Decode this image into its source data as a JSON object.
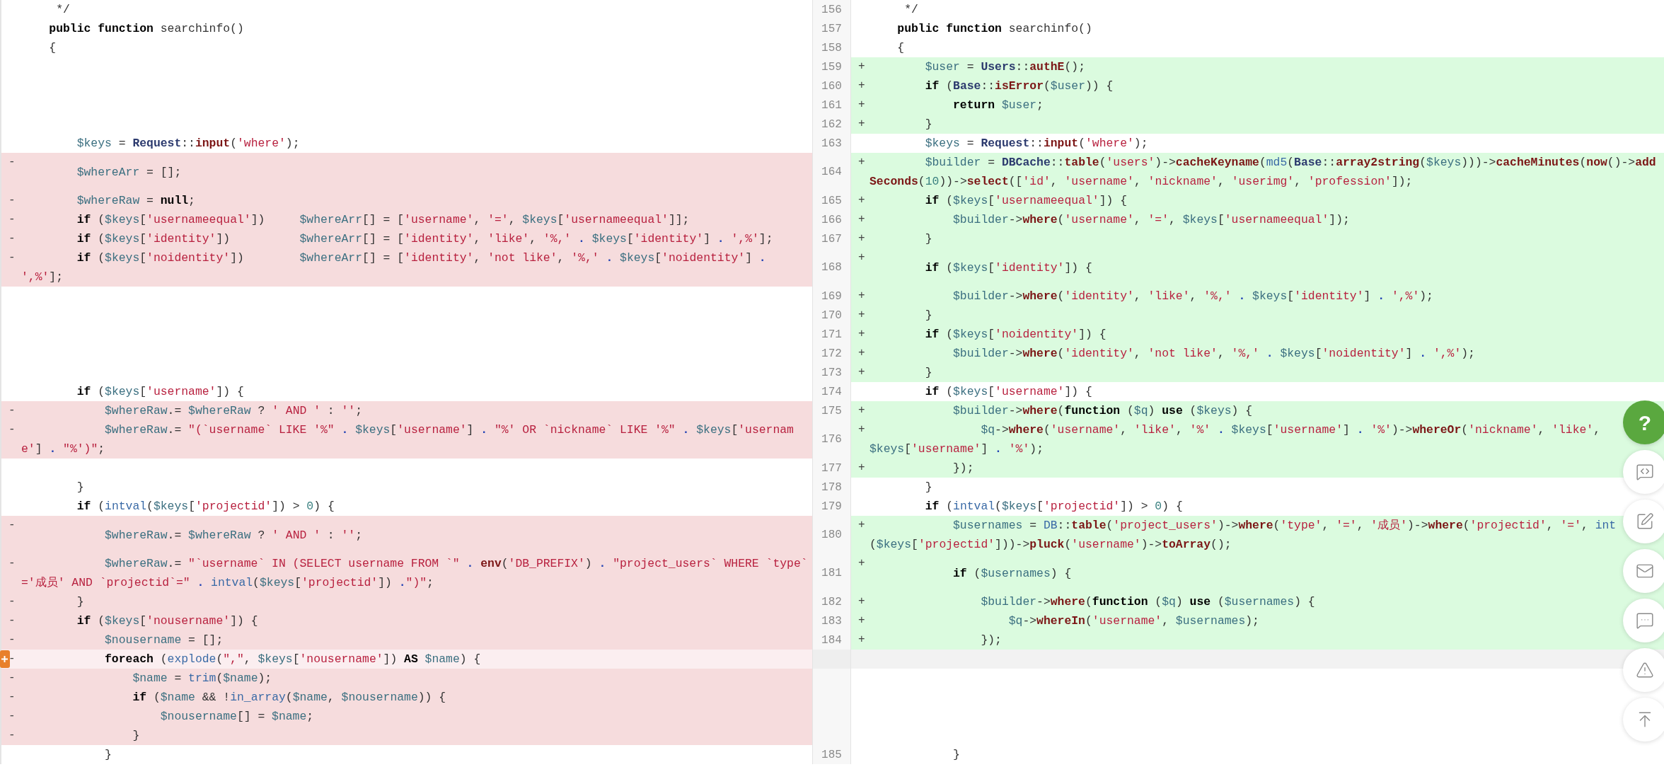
{
  "rows": [
    {
      "left": {
        "kind": "context",
        "lines": [
          [
            "     */"
          ]
        ]
      },
      "right": {
        "kind": "context",
        "number": "156",
        "lines": [
          [
            "     */"
          ]
        ]
      }
    },
    {
      "left": {
        "kind": "context",
        "lines": [
          [
            {
              "kind": "keyword",
              "text": "    public "
            },
            {
              "kind": "keyword",
              "text": "function"
            },
            " searchinfo()"
          ]
        ]
      },
      "right": {
        "kind": "context",
        "number": "157",
        "lines": [
          [
            {
              "kind": "keyword",
              "text": "    public "
            },
            {
              "kind": "keyword",
              "text": "function"
            },
            " searchinfo()"
          ]
        ]
      }
    },
    {
      "left": {
        "kind": "context",
        "lines": [
          [
            "    {"
          ]
        ]
      },
      "right": {
        "kind": "context",
        "number": "158",
        "lines": [
          [
            "    {"
          ]
        ]
      }
    },
    {
      "left": {
        "kind": "empty"
      },
      "right": {
        "kind": "added",
        "number": "159",
        "marker": "+",
        "lines": [
          [
            {
              "kind": "var",
              "text": "        $user"
            },
            " = ",
            {
              "kind": "class",
              "text": "Users"
            },
            "::",
            {
              "kind": "method",
              "text": "authE"
            },
            "();"
          ]
        ]
      }
    },
    {
      "left": {
        "kind": "empty"
      },
      "right": {
        "kind": "added",
        "number": "160",
        "marker": "+",
        "lines": [
          [
            {
              "kind": "keyword",
              "text": "        if"
            },
            " (",
            {
              "kind": "class",
              "text": "Base"
            },
            "::",
            {
              "kind": "method",
              "text": "isError"
            },
            "(",
            {
              "kind": "var",
              "text": "$user"
            },
            ")) {"
          ]
        ]
      }
    },
    {
      "left": {
        "kind": "empty"
      },
      "right": {
        "kind": "added",
        "number": "161",
        "marker": "+",
        "lines": [
          [
            {
              "kind": "keyword",
              "text": "            return "
            },
            {
              "kind": "var",
              "text": "$user"
            },
            ";"
          ]
        ]
      }
    },
    {
      "left": {
        "kind": "empty"
      },
      "right": {
        "kind": "added",
        "number": "162",
        "marker": "+",
        "lines": [
          [
            "        }"
          ]
        ]
      }
    },
    {
      "left": {
        "kind": "context",
        "lines": [
          [
            {
              "kind": "var",
              "text": "        $keys"
            },
            " = ",
            {
              "kind": "class",
              "text": "Request"
            },
            "::",
            {
              "kind": "method",
              "text": "input"
            },
            "(",
            {
              "kind": "string",
              "text": "'where'"
            },
            ");"
          ]
        ]
      },
      "right": {
        "kind": "context",
        "number": "163",
        "lines": [
          [
            {
              "kind": "var",
              "text": "        $keys"
            },
            " = ",
            {
              "kind": "class",
              "text": "Request"
            },
            "::",
            {
              "kind": "method",
              "text": "input"
            },
            "(",
            {
              "kind": "string",
              "text": "'where'"
            },
            ");"
          ]
        ]
      }
    },
    {
      "left": {
        "kind": "removed",
        "marker": "-",
        "highlighted": false,
        "lines": [
          [
            {
              "kind": "var",
              "text": "        $whereArr"
            },
            " = [];"
          ]
        ]
      },
      "right": {
        "kind": "added",
        "number": "164",
        "marker": "+",
        "lines": [
          [
            {
              "kind": "var",
              "text": "        $builder"
            },
            " = ",
            {
              "kind": "class",
              "text": "DBCache"
            },
            "::",
            {
              "kind": "method",
              "text": "table"
            },
            "(",
            {
              "kind": "string",
              "text": "'users'"
            },
            ")->",
            {
              "kind": "method",
              "text": "cacheKeyname"
            },
            "(",
            {
              "kind": "func",
              "text": "md5"
            },
            "(",
            {
              "kind": "class",
              "text": "Base"
            },
            "::",
            {
              "kind": "method",
              "text": "array2string"
            },
            "(",
            {
              "kind": "var",
              "text": "$keys"
            },
            ")))->",
            {
              "kind": "method",
              "text": "cacheMinutes"
            },
            "(",
            {
              "kind": "method",
              "text": "now"
            },
            "()->",
            {
              "kind": "method",
              "text": "add"
            }
          ],
          [
            {
              "kind": "method",
              "text": "Seconds"
            },
            "(",
            {
              "kind": "number",
              "text": "10"
            },
            "))->",
            {
              "kind": "method",
              "text": "select"
            },
            "([",
            {
              "kind": "string",
              "text": "'id'"
            },
            ", ",
            {
              "kind": "string",
              "text": "'username'"
            },
            ", ",
            {
              "kind": "string",
              "text": "'nickname'"
            },
            ", ",
            {
              "kind": "string",
              "text": "'userimg'"
            },
            ", ",
            {
              "kind": "string",
              "text": "'profession'"
            },
            "]);"
          ]
        ]
      }
    },
    {
      "left": {
        "kind": "removed",
        "marker": "-",
        "highlighted": false,
        "lines": [
          [
            {
              "kind": "var",
              "text": "        $whereRaw"
            },
            " = ",
            {
              "kind": "keyword",
              "text": "null"
            },
            ";"
          ]
        ]
      },
      "right": {
        "kind": "added",
        "number": "165",
        "marker": "+",
        "lines": [
          [
            {
              "kind": "keyword",
              "text": "        if"
            },
            " (",
            {
              "kind": "var",
              "text": "$keys"
            },
            "[",
            {
              "kind": "string",
              "text": "'usernameequal'"
            },
            "]) {"
          ]
        ]
      }
    },
    {
      "left": {
        "kind": "removed",
        "marker": "-",
        "highlighted": false,
        "lines": [
          [
            {
              "kind": "keyword",
              "text": "        if"
            },
            " (",
            {
              "kind": "var",
              "text": "$keys"
            },
            "[",
            {
              "kind": "string",
              "text": "'usernameequal'"
            },
            "])     ",
            {
              "kind": "var",
              "text": "$whereArr"
            },
            "[] = [",
            {
              "kind": "string",
              "text": "'username'"
            },
            ", ",
            {
              "kind": "string",
              "text": "'='"
            },
            ", ",
            {
              "kind": "var",
              "text": "$keys"
            },
            "[",
            {
              "kind": "string",
              "text": "'usernameequal'"
            },
            "]];"
          ]
        ]
      },
      "right": {
        "kind": "added",
        "number": "166",
        "marker": "+",
        "lines": [
          [
            {
              "kind": "var",
              "text": "            $builder"
            },
            "->",
            {
              "kind": "method",
              "text": "where"
            },
            "(",
            {
              "kind": "string",
              "text": "'username'"
            },
            ", ",
            {
              "kind": "string",
              "text": "'='"
            },
            ", ",
            {
              "kind": "var",
              "text": "$keys"
            },
            "[",
            {
              "kind": "string",
              "text": "'usernameequal'"
            },
            "]);"
          ]
        ]
      }
    },
    {
      "left": {
        "kind": "removed",
        "marker": "-",
        "highlighted": false,
        "lines": [
          [
            {
              "kind": "keyword",
              "text": "        if"
            },
            " (",
            {
              "kind": "var",
              "text": "$keys"
            },
            "[",
            {
              "kind": "string",
              "text": "'identity'"
            },
            "])          ",
            {
              "kind": "var",
              "text": "$whereArr"
            },
            "[] = [",
            {
              "kind": "string",
              "text": "'identity'"
            },
            ", ",
            {
              "kind": "string",
              "text": "'like'"
            },
            ", ",
            {
              "kind": "string",
              "text": "'%,' "
            },
            {
              "kind": "concat",
              "text": "."
            },
            {
              "kind": "var",
              "text": " $keys"
            },
            "[",
            {
              "kind": "string",
              "text": "'identity'"
            },
            "] ",
            {
              "kind": "concat",
              "text": "."
            },
            {
              "kind": "string",
              "text": " ',%'"
            },
            "];"
          ]
        ]
      },
      "right": {
        "kind": "added",
        "number": "167",
        "marker": "+",
        "lines": [
          [
            "        }"
          ]
        ]
      }
    },
    {
      "left": {
        "kind": "removed",
        "marker": "-",
        "highlighted": false,
        "lines": [
          [
            {
              "kind": "keyword",
              "text": "        if"
            },
            " (",
            {
              "kind": "var",
              "text": "$keys"
            },
            "[",
            {
              "kind": "string",
              "text": "'noidentity'"
            },
            "])        ",
            {
              "kind": "var",
              "text": "$whereArr"
            },
            "[] = [",
            {
              "kind": "string",
              "text": "'identity'"
            },
            ", ",
            {
              "kind": "string",
              "text": "'not like'"
            },
            ", ",
            {
              "kind": "string",
              "text": "'%,' "
            },
            {
              "kind": "concat",
              "text": "."
            },
            {
              "kind": "var",
              "text": " $keys"
            },
            "[",
            {
              "kind": "string",
              "text": "'noidentity'"
            },
            "] ",
            {
              "kind": "concat",
              "text": "."
            }
          ],
          [
            {
              "kind": "string",
              "text": "',%'"
            },
            "];"
          ]
        ]
      },
      "right": {
        "kind": "added",
        "number": "168",
        "marker": "+",
        "lines": [
          [
            {
              "kind": "keyword",
              "text": "        if"
            },
            " (",
            {
              "kind": "var",
              "text": "$keys"
            },
            "[",
            {
              "kind": "string",
              "text": "'identity'"
            },
            "]) {"
          ]
        ]
      }
    },
    {
      "left": {
        "kind": "empty"
      },
      "right": {
        "kind": "added",
        "number": "169",
        "marker": "+",
        "lines": [
          [
            {
              "kind": "var",
              "text": "            $builder"
            },
            "->",
            {
              "kind": "method",
              "text": "where"
            },
            "(",
            {
              "kind": "string",
              "text": "'identity'"
            },
            ", ",
            {
              "kind": "string",
              "text": "'like'"
            },
            ", ",
            {
              "kind": "string",
              "text": "'%,' "
            },
            {
              "kind": "concat",
              "text": "."
            },
            {
              "kind": "var",
              "text": " $keys"
            },
            "[",
            {
              "kind": "string",
              "text": "'identity'"
            },
            "] ",
            {
              "kind": "concat",
              "text": "."
            },
            {
              "kind": "string",
              "text": " ',%'"
            },
            ");"
          ]
        ]
      }
    },
    {
      "left": {
        "kind": "empty"
      },
      "right": {
        "kind": "added",
        "number": "170",
        "marker": "+",
        "lines": [
          [
            "        }"
          ]
        ]
      }
    },
    {
      "left": {
        "kind": "empty"
      },
      "right": {
        "kind": "added",
        "number": "171",
        "marker": "+",
        "lines": [
          [
            {
              "kind": "keyword",
              "text": "        if"
            },
            " (",
            {
              "kind": "var",
              "text": "$keys"
            },
            "[",
            {
              "kind": "string",
              "text": "'noidentity'"
            },
            "]) {"
          ]
        ]
      }
    },
    {
      "left": {
        "kind": "empty"
      },
      "right": {
        "kind": "added",
        "number": "172",
        "marker": "+",
        "lines": [
          [
            {
              "kind": "var",
              "text": "            $builder"
            },
            "->",
            {
              "kind": "method",
              "text": "where"
            },
            "(",
            {
              "kind": "string",
              "text": "'identity'"
            },
            ", ",
            {
              "kind": "string",
              "text": "'not like'"
            },
            ", ",
            {
              "kind": "string",
              "text": "'%,' "
            },
            {
              "kind": "concat",
              "text": "."
            },
            {
              "kind": "var",
              "text": " $keys"
            },
            "[",
            {
              "kind": "string",
              "text": "'noidentity'"
            },
            "] ",
            {
              "kind": "concat",
              "text": "."
            },
            {
              "kind": "string",
              "text": " ',%'"
            },
            ");"
          ]
        ]
      }
    },
    {
      "left": {
        "kind": "empty"
      },
      "right": {
        "kind": "added",
        "number": "173",
        "marker": "+",
        "lines": [
          [
            "        }"
          ]
        ]
      }
    },
    {
      "left": {
        "kind": "context",
        "lines": [
          [
            {
              "kind": "keyword",
              "text": "        if"
            },
            " (",
            {
              "kind": "var",
              "text": "$keys"
            },
            "[",
            {
              "kind": "string",
              "text": "'username'"
            },
            "]) {"
          ]
        ]
      },
      "right": {
        "kind": "context",
        "number": "174",
        "lines": [
          [
            {
              "kind": "keyword",
              "text": "        if"
            },
            " (",
            {
              "kind": "var",
              "text": "$keys"
            },
            "[",
            {
              "kind": "string",
              "text": "'username'"
            },
            "]) {"
          ]
        ]
      }
    },
    {
      "left": {
        "kind": "removed",
        "marker": "-",
        "highlighted": false,
        "lines": [
          [
            {
              "kind": "var",
              "text": "            $whereRaw"
            },
            ".= ",
            {
              "kind": "var",
              "text": "$whereRaw"
            },
            " ? ",
            {
              "kind": "string",
              "text": "' AND '"
            },
            " : ",
            {
              "kind": "string",
              "text": "''"
            },
            ";"
          ]
        ]
      },
      "right": {
        "kind": "added",
        "number": "175",
        "marker": "+",
        "lines": [
          [
            {
              "kind": "var",
              "text": "            $builder"
            },
            "->",
            {
              "kind": "method",
              "text": "where"
            },
            "(",
            {
              "kind": "keyword",
              "text": "function"
            },
            " (",
            {
              "kind": "var",
              "text": "$q"
            },
            ") ",
            {
              "kind": "keyword",
              "text": "use"
            },
            " (",
            {
              "kind": "var",
              "text": "$keys"
            },
            ") {"
          ]
        ]
      }
    },
    {
      "left": {
        "kind": "removed",
        "marker": "-",
        "highlighted": false,
        "lines": [
          [
            {
              "kind": "var",
              "text": "            $whereRaw"
            },
            ".= ",
            {
              "kind": "string",
              "text": "\"(`username` LIKE '%\" "
            },
            {
              "kind": "concat",
              "text": "."
            },
            {
              "kind": "var",
              "text": " $keys"
            },
            "[",
            {
              "kind": "string",
              "text": "'username'"
            },
            "] ",
            {
              "kind": "concat",
              "text": "."
            },
            {
              "kind": "string",
              "text": " \"%' OR `nickname` LIKE '%\" "
            },
            {
              "kind": "concat",
              "text": "."
            },
            {
              "kind": "var",
              "text": " $keys"
            },
            "[",
            {
              "kind": "string",
              "text": "'usernam"
            }
          ],
          [
            {
              "kind": "string",
              "text": "e'"
            },
            "] ",
            {
              "kind": "concat",
              "text": "."
            },
            {
              "kind": "string",
              "text": " \"%')\""
            },
            ";"
          ]
        ]
      },
      "right": {
        "kind": "added",
        "number": "176",
        "marker": "+",
        "lines": [
          [
            {
              "kind": "var",
              "text": "                $q"
            },
            "->",
            {
              "kind": "method",
              "text": "where"
            },
            "(",
            {
              "kind": "string",
              "text": "'username'"
            },
            ", ",
            {
              "kind": "string",
              "text": "'like'"
            },
            ", ",
            {
              "kind": "string",
              "text": "'%' "
            },
            {
              "kind": "concat",
              "text": "."
            },
            {
              "kind": "var",
              "text": " $keys"
            },
            "[",
            {
              "kind": "string",
              "text": "'username'"
            },
            "] ",
            {
              "kind": "concat",
              "text": "."
            },
            {
              "kind": "string",
              "text": " '%'"
            },
            ")->",
            {
              "kind": "method",
              "text": "whereOr"
            },
            "(",
            {
              "kind": "string",
              "text": "'nickname'"
            },
            ", ",
            {
              "kind": "string",
              "text": "'like'"
            },
            ","
          ],
          [
            {
              "kind": "var",
              "text": "$keys"
            },
            "[",
            {
              "kind": "string",
              "text": "'username'"
            },
            "] ",
            {
              "kind": "concat",
              "text": "."
            },
            {
              "kind": "string",
              "text": " '%'"
            },
            ");"
          ]
        ]
      }
    },
    {
      "left": {
        "kind": "empty"
      },
      "right": {
        "kind": "added",
        "number": "177",
        "marker": "+",
        "lines": [
          [
            "            });"
          ]
        ]
      }
    },
    {
      "left": {
        "kind": "context",
        "lines": [
          [
            "        }"
          ]
        ]
      },
      "right": {
        "kind": "context",
        "number": "178",
        "lines": [
          [
            "        }"
          ]
        ]
      }
    },
    {
      "left": {
        "kind": "context",
        "lines": [
          [
            {
              "kind": "keyword",
              "text": "        if"
            },
            " (",
            {
              "kind": "func",
              "text": "intval"
            },
            "(",
            {
              "kind": "var",
              "text": "$keys"
            },
            "[",
            {
              "kind": "string",
              "text": "'projectid'"
            },
            "]) > ",
            {
              "kind": "number",
              "text": "0"
            },
            ") {"
          ]
        ]
      },
      "right": {
        "kind": "context",
        "number": "179",
        "lines": [
          [
            {
              "kind": "keyword",
              "text": "        if"
            },
            " (",
            {
              "kind": "func",
              "text": "intval"
            },
            "(",
            {
              "kind": "var",
              "text": "$keys"
            },
            "[",
            {
              "kind": "string",
              "text": "'projectid'"
            },
            "]) > ",
            {
              "kind": "number",
              "text": "0"
            },
            ") {"
          ]
        ]
      }
    },
    {
      "left": {
        "kind": "removed",
        "marker": "-",
        "highlighted": false,
        "lines": [
          [
            {
              "kind": "var",
              "text": "            $whereRaw"
            },
            ".= ",
            {
              "kind": "var",
              "text": "$whereRaw"
            },
            " ? ",
            {
              "kind": "string",
              "text": "' AND '"
            },
            " : ",
            {
              "kind": "string",
              "text": "''"
            },
            ";"
          ]
        ]
      },
      "right": {
        "kind": "added",
        "number": "180",
        "marker": "+",
        "lines": [
          [
            {
              "kind": "var",
              "text": "            $usernames"
            },
            " = ",
            {
              "kind": "func",
              "text": "DB"
            },
            "::",
            {
              "kind": "method",
              "text": "table"
            },
            "(",
            {
              "kind": "string",
              "text": "'project_users'"
            },
            ")->",
            {
              "kind": "method",
              "text": "where"
            },
            "(",
            {
              "kind": "string",
              "text": "'type'"
            },
            ", ",
            {
              "kind": "string",
              "text": "'='"
            },
            ", ",
            {
              "kind": "string",
              "text": "'成员'"
            },
            ")->",
            {
              "kind": "method",
              "text": "where"
            },
            "(",
            {
              "kind": "string",
              "text": "'projectid'"
            },
            ", ",
            {
              "kind": "string",
              "text": "'='"
            },
            ", ",
            {
              "kind": "func",
              "text": "int"
            }
          ],
          [
            "(",
            {
              "kind": "var",
              "text": "$keys"
            },
            "[",
            {
              "kind": "string",
              "text": "'projectid'"
            },
            "]))->",
            {
              "kind": "method",
              "text": "pluck"
            },
            "(",
            {
              "kind": "string",
              "text": "'username'"
            },
            ")->",
            {
              "kind": "method",
              "text": "toArray"
            },
            "();"
          ]
        ]
      }
    },
    {
      "left": {
        "kind": "removed",
        "marker": "-",
        "highlighted": false,
        "lines": [
          [
            {
              "kind": "var",
              "text": "            $whereRaw"
            },
            ".= ",
            {
              "kind": "string",
              "text": "\"`username` IN (SELECT username FROM `\" "
            },
            {
              "kind": "concat",
              "text": "."
            },
            {
              "kind": "method",
              "text": " env"
            },
            "(",
            {
              "kind": "string",
              "text": "'DB_PREFIX'"
            },
            ") ",
            {
              "kind": "concat",
              "text": "."
            },
            {
              "kind": "string",
              "text": " \"project_users` WHERE `type`"
            }
          ],
          [
            {
              "kind": "string",
              "text": "='成员' AND `projectid`=\" "
            },
            {
              "kind": "concat",
              "text": "."
            },
            {
              "kind": "func",
              "text": " intval"
            },
            "(",
            {
              "kind": "var",
              "text": "$keys"
            },
            "[",
            {
              "kind": "string",
              "text": "'projectid'"
            },
            "]) ",
            {
              "kind": "concat",
              "text": "."
            },
            {
              "kind": "string",
              "text": "\")\""
            },
            ";"
          ]
        ]
      },
      "right": {
        "kind": "added",
        "number": "181",
        "marker": "+",
        "lines": [
          [
            {
              "kind": "keyword",
              "text": "            if"
            },
            " (",
            {
              "kind": "var",
              "text": "$usernames"
            },
            ") {"
          ]
        ]
      }
    },
    {
      "left": {
        "kind": "removed",
        "marker": "-",
        "highlighted": false,
        "lines": [
          [
            "        }"
          ]
        ]
      },
      "right": {
        "kind": "added",
        "number": "182",
        "marker": "+",
        "lines": [
          [
            {
              "kind": "var",
              "text": "                $builder"
            },
            "->",
            {
              "kind": "method",
              "text": "where"
            },
            "(",
            {
              "kind": "keyword",
              "text": "function"
            },
            " (",
            {
              "kind": "var",
              "text": "$q"
            },
            ") ",
            {
              "kind": "keyword",
              "text": "use"
            },
            " (",
            {
              "kind": "var",
              "text": "$usernames"
            },
            ") {"
          ]
        ]
      }
    },
    {
      "left": {
        "kind": "removed",
        "marker": "-",
        "highlighted": false,
        "lines": [
          [
            {
              "kind": "keyword",
              "text": "        if"
            },
            " (",
            {
              "kind": "var",
              "text": "$keys"
            },
            "[",
            {
              "kind": "string",
              "text": "'nousername'"
            },
            "]) {"
          ]
        ]
      },
      "right": {
        "kind": "added",
        "number": "183",
        "marker": "+",
        "lines": [
          [
            {
              "kind": "var",
              "text": "                    $q"
            },
            "->",
            {
              "kind": "method",
              "text": "whereIn"
            },
            "(",
            {
              "kind": "string",
              "text": "'username'"
            },
            ", ",
            {
              "kind": "var",
              "text": "$usernames"
            },
            ");"
          ]
        ]
      }
    },
    {
      "left": {
        "kind": "removed",
        "marker": "-",
        "highlighted": false,
        "lines": [
          [
            {
              "kind": "var",
              "text": "            $nousername"
            },
            " = [];"
          ]
        ]
      },
      "right": {
        "kind": "added",
        "number": "184",
        "marker": "+",
        "lines": [
          [
            "                });"
          ]
        ]
      }
    },
    {
      "left": {
        "kind": "removed",
        "marker": "-",
        "highlighted": true,
        "lines": [
          [
            {
              "kind": "keyword",
              "text": "            foreach"
            },
            " (",
            {
              "kind": "func",
              "text": "explode"
            },
            "(",
            {
              "kind": "string",
              "text": "\",\""
            },
            ", ",
            {
              "kind": "var",
              "text": "$keys"
            },
            "[",
            {
              "kind": "string",
              "text": "'nousername'"
            },
            "]) ",
            {
              "kind": "keyword",
              "text": "AS"
            },
            {
              "kind": "var",
              "text": " $name"
            },
            ") {"
          ]
        ]
      },
      "right": {
        "kind": "filler"
      }
    },
    {
      "left": {
        "kind": "removed",
        "marker": "-",
        "highlighted": false,
        "lines": [
          [
            {
              "kind": "var",
              "text": "                $name"
            },
            " = ",
            {
              "kind": "func",
              "text": "trim"
            },
            "(",
            {
              "kind": "var",
              "text": "$name"
            },
            ");"
          ]
        ]
      },
      "right": {
        "kind": "empty"
      }
    },
    {
      "left": {
        "kind": "removed",
        "marker": "-",
        "highlighted": false,
        "lines": [
          [
            {
              "kind": "keyword",
              "text": "                if"
            },
            " (",
            {
              "kind": "var",
              "text": "$name"
            },
            " && !",
            {
              "kind": "func",
              "text": "in_array"
            },
            "(",
            {
              "kind": "var",
              "text": "$name"
            },
            ", ",
            {
              "kind": "var",
              "text": "$nousername"
            },
            ")) {"
          ]
        ]
      },
      "right": {
        "kind": "empty"
      }
    },
    {
      "left": {
        "kind": "removed",
        "marker": "-",
        "highlighted": false,
        "lines": [
          [
            {
              "kind": "var",
              "text": "                    $nousername"
            },
            "[] = ",
            {
              "kind": "var",
              "text": "$name"
            },
            ";"
          ]
        ]
      },
      "right": {
        "kind": "empty"
      }
    },
    {
      "left": {
        "kind": "removed",
        "marker": "-",
        "highlighted": false,
        "lines": [
          [
            "                }"
          ]
        ]
      },
      "right": {
        "kind": "empty"
      }
    },
    {
      "left": {
        "kind": "context",
        "lines": [
          [
            "            }"
          ]
        ]
      },
      "right": {
        "kind": "context",
        "number": "185",
        "lines": [
          [
            "            }"
          ]
        ]
      }
    }
  ],
  "floating_buttons": [
    {
      "kind": "help",
      "label": "?"
    },
    {
      "kind": "code"
    },
    {
      "kind": "edit"
    },
    {
      "kind": "mail"
    },
    {
      "kind": "comment"
    },
    {
      "kind": "warning"
    },
    {
      "kind": "top"
    }
  ]
}
